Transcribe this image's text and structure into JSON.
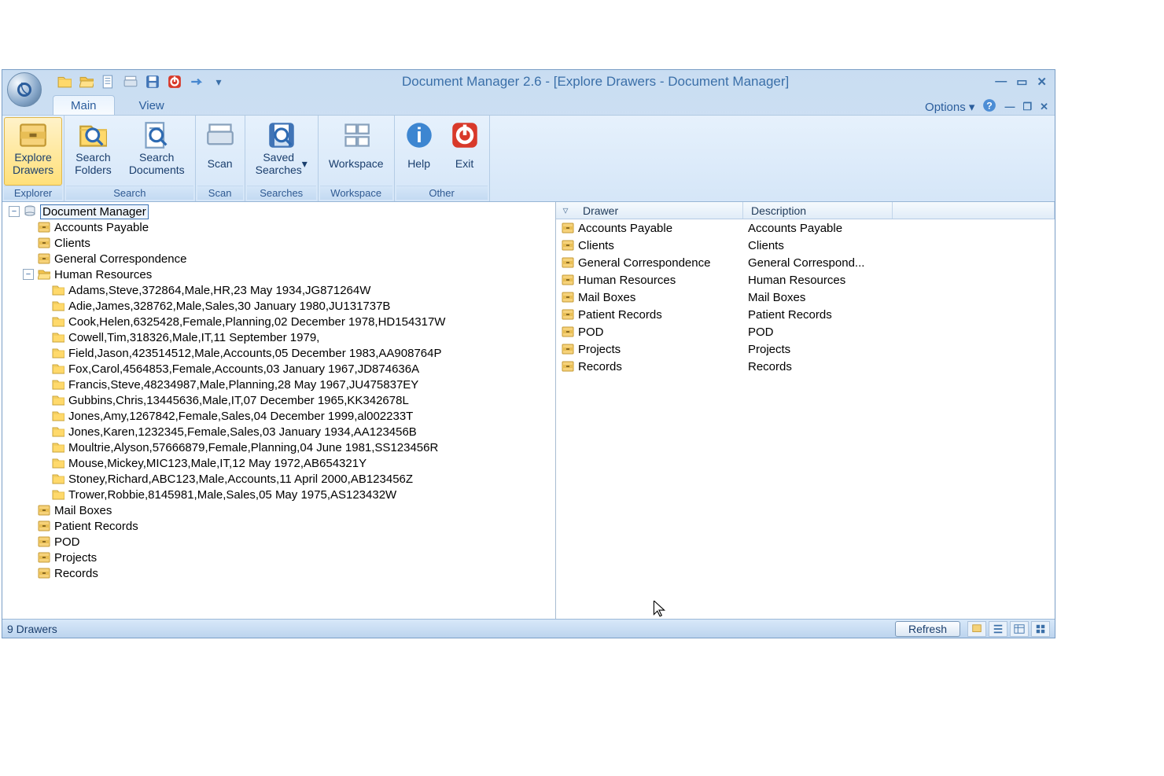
{
  "title": "Document Manager 2.6 - [Explore Drawers - Document Manager]",
  "tabs": {
    "main": "Main",
    "view": "View"
  },
  "options_label": "Options",
  "ribbon": {
    "explorer": {
      "label": "Explorer",
      "explore_drawers": "Explore\nDrawers"
    },
    "search": {
      "label": "Search",
      "search_folders": "Search\nFolders",
      "search_documents": "Search\nDocuments"
    },
    "scan": {
      "label": "Scan",
      "scan": "Scan"
    },
    "searches": {
      "label": "Searches",
      "saved_searches": "Saved\nSearches"
    },
    "workspace": {
      "label": "Workspace",
      "workspace": "Workspace"
    },
    "other": {
      "label": "Other",
      "help": "Help",
      "exit": "Exit"
    }
  },
  "tree": {
    "root": "Document Manager",
    "drawers": [
      "Accounts Payable",
      "Clients",
      "General Correspondence",
      "Human Resources",
      "Mail Boxes",
      "Patient Records",
      "POD",
      "Projects",
      "Records"
    ],
    "hr_children": [
      "Adams,Steve,372864,Male,HR,23 May 1934,JG871264W",
      "Adie,James,328762,Male,Sales,30 January 1980,JU131737B",
      "Cook,Helen,6325428,Female,Planning,02 December 1978,HD154317W",
      "Cowell,Tim,318326,Male,IT,11 September 1979,",
      "Field,Jason,423514512,Male,Accounts,05 December 1983,AA908764P",
      "Fox,Carol,4564853,Female,Accounts,03 January 1967,JD874636A",
      "Francis,Steve,48234987,Male,Planning,28 May 1967,JU475837EY",
      "Gubbins,Chris,13445636,Male,IT,07 December 1965,KK342678L",
      "Jones,Amy,1267842,Female,Sales,04 December 1999,al002233T",
      "Jones,Karen,1232345,Female,Sales,03 January 1934,AA123456B",
      "Moultrie,Alyson,57666879,Female,Planning,04 June 1981,SS123456R",
      "Mouse,Mickey,MIC123,Male,IT,12 May 1972,AB654321Y",
      "Stoney,Richard,ABC123,Male,Accounts,11 April 2000,AB123456Z",
      "Trower,Robbie,8145981,Male,Sales,05 May 1975,AS123432W"
    ]
  },
  "list": {
    "col_drawer": "Drawer",
    "col_description": "Description",
    "rows": [
      {
        "name": "Accounts Payable",
        "desc": "Accounts Payable"
      },
      {
        "name": "Clients",
        "desc": "Clients"
      },
      {
        "name": "General Correspondence",
        "desc": "General Correspond..."
      },
      {
        "name": "Human Resources",
        "desc": "Human Resources"
      },
      {
        "name": "Mail Boxes",
        "desc": "Mail Boxes"
      },
      {
        "name": "Patient Records",
        "desc": "Patient Records"
      },
      {
        "name": "POD",
        "desc": "POD"
      },
      {
        "name": "Projects",
        "desc": "Projects"
      },
      {
        "name": "Records",
        "desc": "Records"
      }
    ]
  },
  "status": {
    "text": "9 Drawers",
    "refresh": "Refresh"
  }
}
